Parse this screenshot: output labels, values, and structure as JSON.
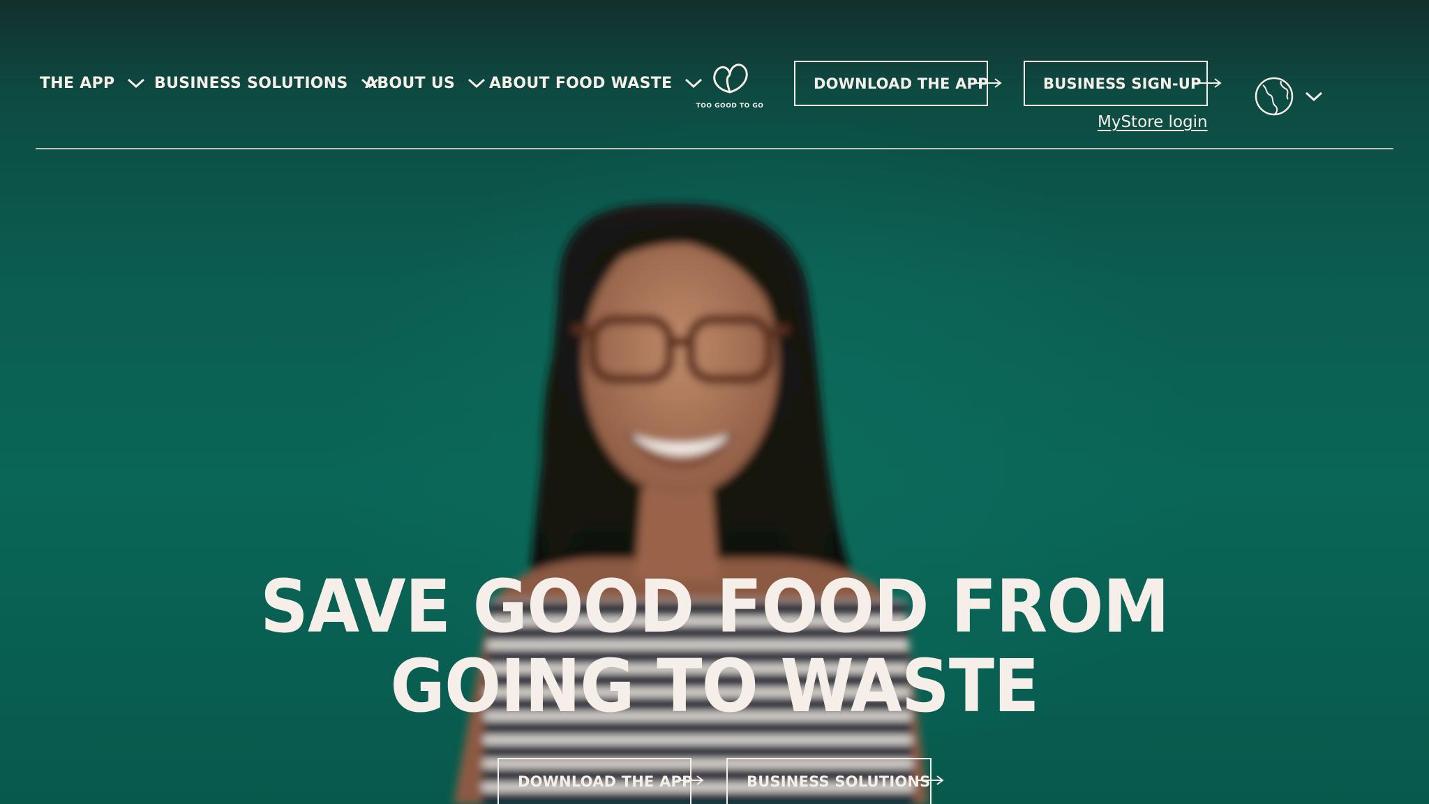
{
  "nav": {
    "items": [
      {
        "label": "THE APP"
      },
      {
        "label": "BUSINESS SOLUTIONS"
      },
      {
        "label": "ABOUT US"
      },
      {
        "label": "ABOUT FOOD WASTE"
      }
    ]
  },
  "logo": {
    "text": "TOO GOOD TO GO"
  },
  "header": {
    "download_label": "DOWNLOAD THE APP",
    "business_signup_label": "BUSINESS SIGN-UP",
    "mystore_login_label": "MyStore login"
  },
  "hero": {
    "title_line1": "SAVE GOOD FOOD FROM",
    "title_line2": "GOING TO WASTE",
    "cta_download_label": "DOWNLOAD THE APP",
    "cta_business_label": "BUSINESS SOLUTIONS"
  },
  "colors": {
    "text": "#f6efe9",
    "background": "#0a6657",
    "header_dark": "#132f2c"
  },
  "icons": [
    "chevron-down-icon",
    "logo-icon",
    "arrow-right-icon",
    "globe-icon"
  ]
}
